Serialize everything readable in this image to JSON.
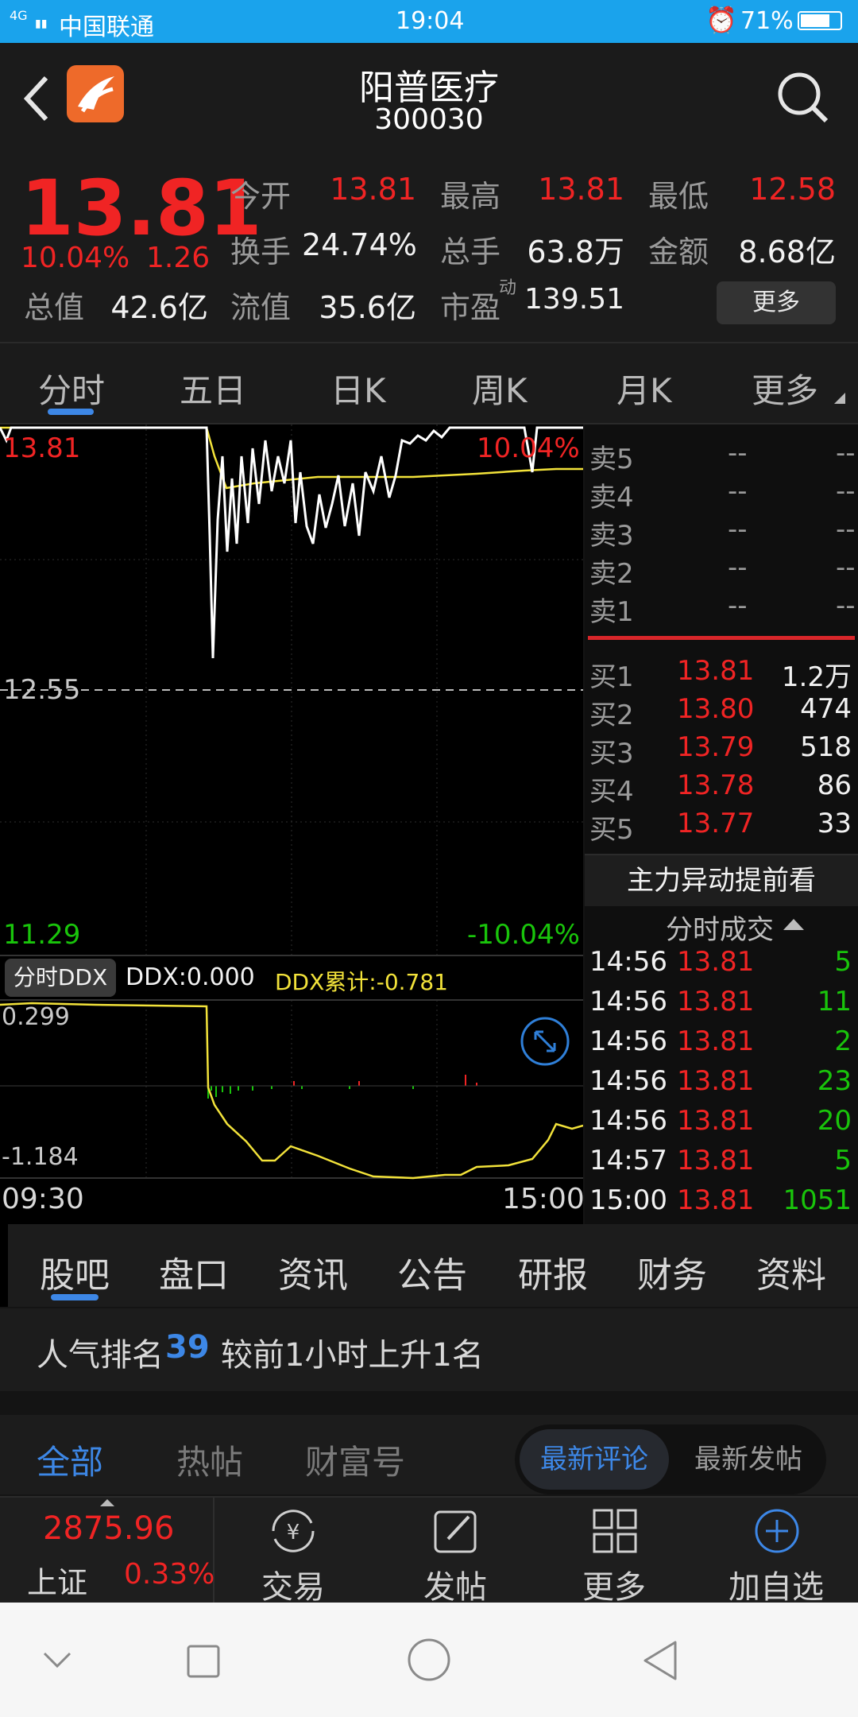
{
  "status_bar": {
    "network": "4G",
    "carrier": "中国联通",
    "time": "19:04",
    "battery": "71%"
  },
  "header": {
    "title": "阳普医疗",
    "code": "300030"
  },
  "quote": {
    "price": "13.81",
    "change_pct": "10.04%",
    "change": "1.26",
    "open_label": "今开",
    "open": "13.81",
    "high_label": "最高",
    "high": "13.81",
    "low_label": "最低",
    "low": "12.58",
    "turnover_rate_label": "换手",
    "turnover_rate": "24.74%",
    "volume_label": "总手",
    "volume": "63.8万",
    "amount_label": "金额",
    "amount": "8.68亿",
    "mcap_label": "总值",
    "mcap": "42.6亿",
    "float_label": "流值",
    "float": "35.6亿",
    "pe_label": "市盈",
    "pe_sup": "动",
    "pe": "139.51",
    "more_button": "更多"
  },
  "ktabs": [
    "分时",
    "五日",
    "日K",
    "周K",
    "月K",
    "更多"
  ],
  "chart": {
    "top_price": "13.81",
    "top_pct": "10.04%",
    "mid_price": "12.55",
    "bottom_price": "11.29",
    "bottom_pct": "-10.04%",
    "ddx_tab": "分时DDX",
    "ddx": "DDX:0.000",
    "ddx_cum": "DDX累计:-0.781",
    "ddx_top": "0.299",
    "ddx_bottom": "-1.184",
    "time_start": "09:30",
    "time_end": "15:00"
  },
  "orderbook": {
    "sell": [
      {
        "label": "卖5",
        "price": "--",
        "vol": "--"
      },
      {
        "label": "卖4",
        "price": "--",
        "vol": "--"
      },
      {
        "label": "卖3",
        "price": "--",
        "vol": "--"
      },
      {
        "label": "卖2",
        "price": "--",
        "vol": "--"
      },
      {
        "label": "卖1",
        "price": "--",
        "vol": "--"
      }
    ],
    "buy": [
      {
        "label": "买1",
        "price": "13.81",
        "vol": "1.2万"
      },
      {
        "label": "买2",
        "price": "13.80",
        "vol": "474"
      },
      {
        "label": "买3",
        "price": "13.79",
        "vol": "518"
      },
      {
        "label": "买4",
        "price": "13.78",
        "vol": "86"
      },
      {
        "label": "买5",
        "price": "13.77",
        "vol": "33"
      }
    ],
    "promo": "主力异动提前看",
    "trades_title": "分时成交",
    "trades": [
      {
        "time": "14:56",
        "price": "13.81",
        "vol": "5"
      },
      {
        "time": "14:56",
        "price": "13.81",
        "vol": "11"
      },
      {
        "time": "14:56",
        "price": "13.81",
        "vol": "2"
      },
      {
        "time": "14:56",
        "price": "13.81",
        "vol": "23"
      },
      {
        "time": "14:56",
        "price": "13.81",
        "vol": "20"
      },
      {
        "time": "14:57",
        "price": "13.81",
        "vol": "5"
      },
      {
        "time": "15:00",
        "price": "13.81",
        "vol": "1051"
      }
    ]
  },
  "btabs": [
    "股吧",
    "盘口",
    "资讯",
    "公告",
    "研报",
    "财务",
    "资料"
  ],
  "rank": {
    "prefix": "人气排名",
    "rank": "39",
    "suffix": "较前1小时上升1名"
  },
  "filter": {
    "tabs": [
      "全部",
      "热帖",
      "财富号"
    ],
    "seg": [
      "最新评论",
      "最新发帖"
    ]
  },
  "bottom_nav": {
    "index_value": "2875.96",
    "index_name": "上证",
    "index_pct": "0.33%",
    "items": [
      "交易",
      "发帖",
      "更多",
      "加自选"
    ]
  },
  "colors": {
    "red": "#f02424",
    "green": "#19c40b",
    "blue": "#3d87e6",
    "yellow": "#f2e23a",
    "status": "#1aa3ec"
  }
}
